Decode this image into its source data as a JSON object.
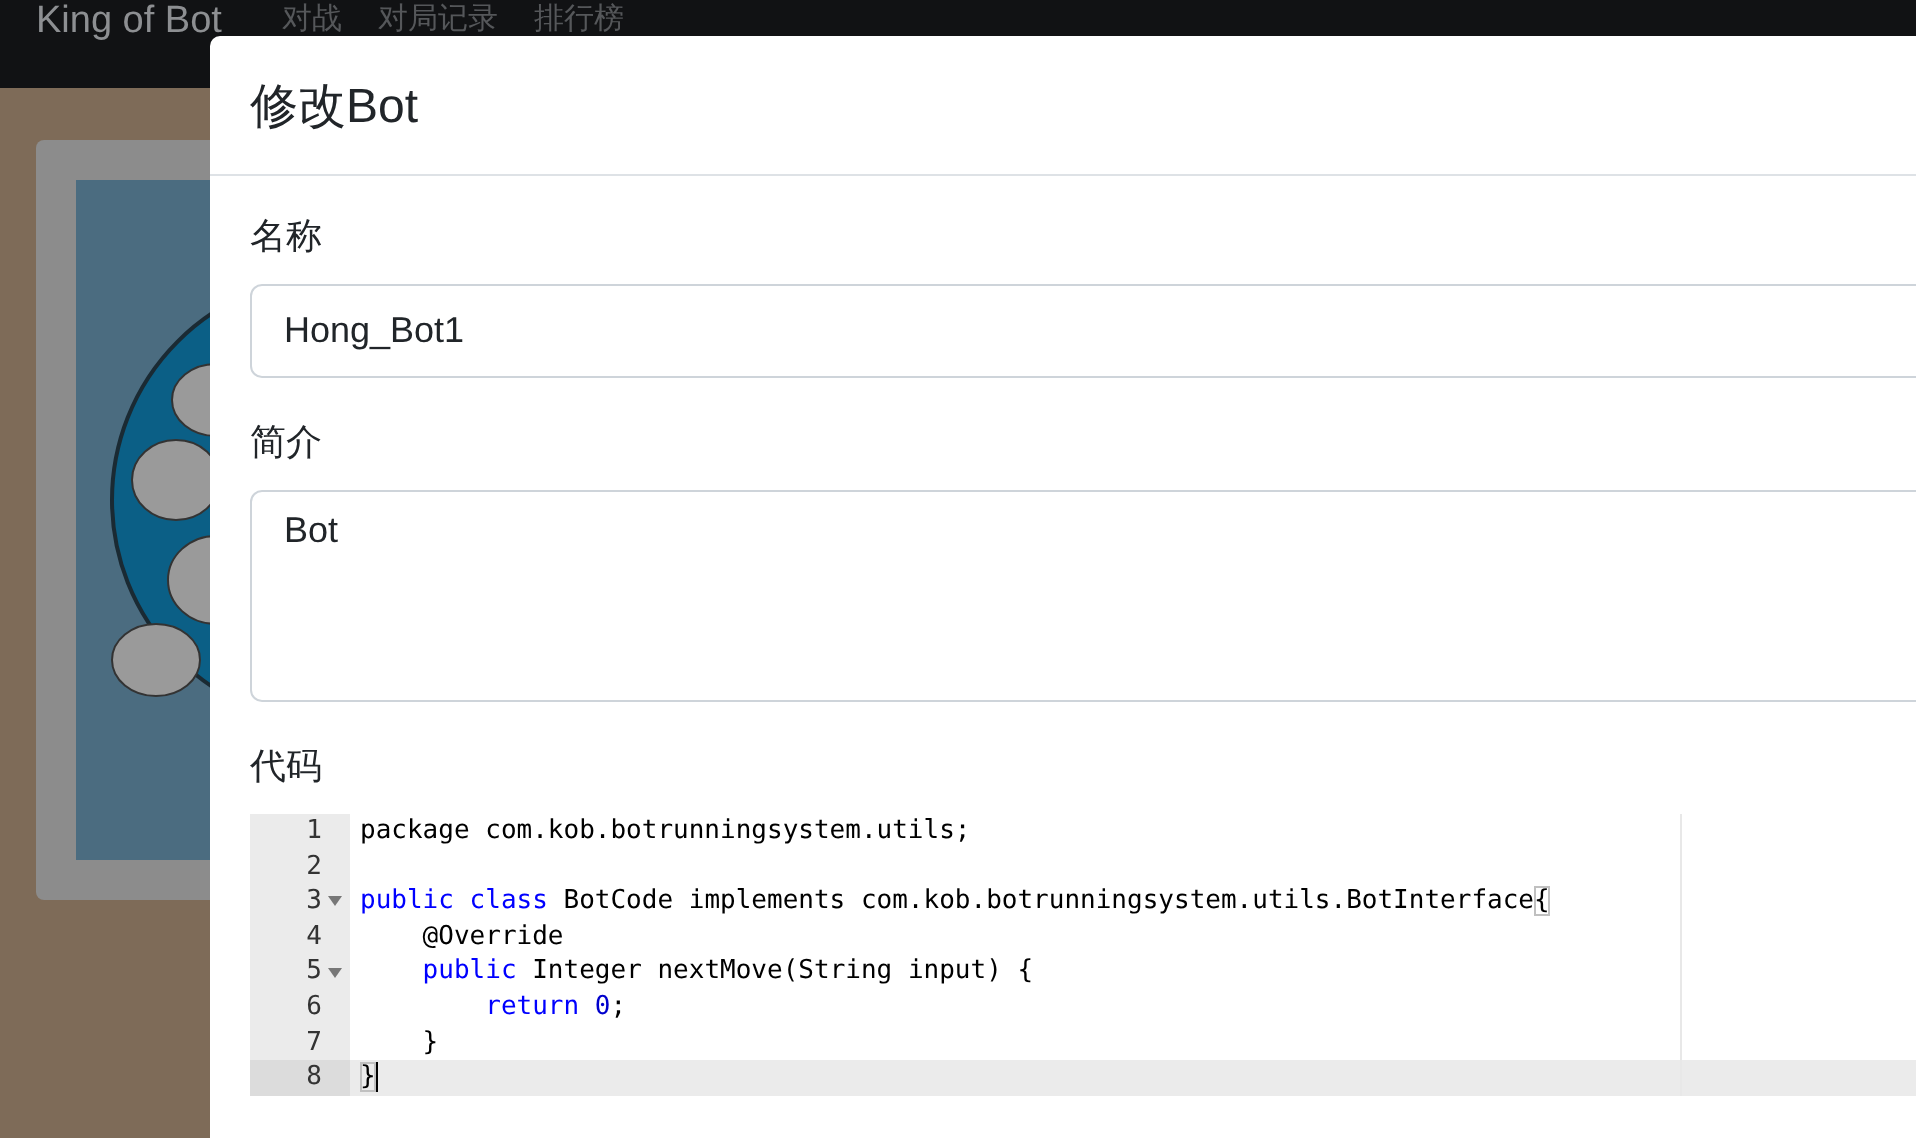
{
  "navbar": {
    "brand": "King of Bot",
    "links": [
      "对战",
      "对局记录",
      "排行榜"
    ]
  },
  "modal": {
    "title": "修改Bot",
    "fields": [
      {
        "label": "名称",
        "kind": "input",
        "value": "Hong_Bot1"
      },
      {
        "label": "简介",
        "kind": "textarea",
        "value": "Bot"
      }
    ],
    "code": {
      "label": "代码",
      "lines": [
        {
          "number": "1",
          "foldable": false,
          "active": false,
          "tokens": [
            {
              "text": "package com.kob.botrunningsystem.utils;",
              "kind": "plain"
            }
          ]
        },
        {
          "number": "2",
          "foldable": false,
          "active": false
        },
        {
          "number": "3",
          "foldable": true,
          "active": false,
          "tokens": [
            {
              "text": "public class",
              "kind": "keyword"
            },
            {
              "text": " BotCode implements com.kob.botrunningsystem.utils.BotInterface",
              "kind": "plain"
            },
            {
              "text": "{",
              "kind": "matched-bracket"
            }
          ]
        },
        {
          "number": "4",
          "foldable": false,
          "active": false,
          "tokens": [
            {
              "text": "    @Override",
              "kind": "plain"
            }
          ]
        },
        {
          "number": "5",
          "foldable": true,
          "active": false,
          "tokens": [
            {
              "text": "    public",
              "kind": "keyword"
            },
            {
              "text": " Integer nextMove(String input) {",
              "kind": "plain"
            }
          ]
        },
        {
          "number": "6",
          "foldable": false,
          "active": false,
          "tokens": [
            {
              "text": "        return",
              "kind": "keyword"
            },
            {
              "text": " 0",
              "kind": "number"
            },
            {
              "text": ";",
              "kind": "plain"
            }
          ]
        },
        {
          "number": "7",
          "foldable": false,
          "active": false,
          "tokens": [
            {
              "text": "    }",
              "kind": "plain"
            }
          ]
        },
        {
          "number": "8",
          "foldable": false,
          "active": true,
          "tokens": [
            {
              "text": "}",
              "kind": "matched-bracket"
            }
          ]
        }
      ]
    }
  }
}
